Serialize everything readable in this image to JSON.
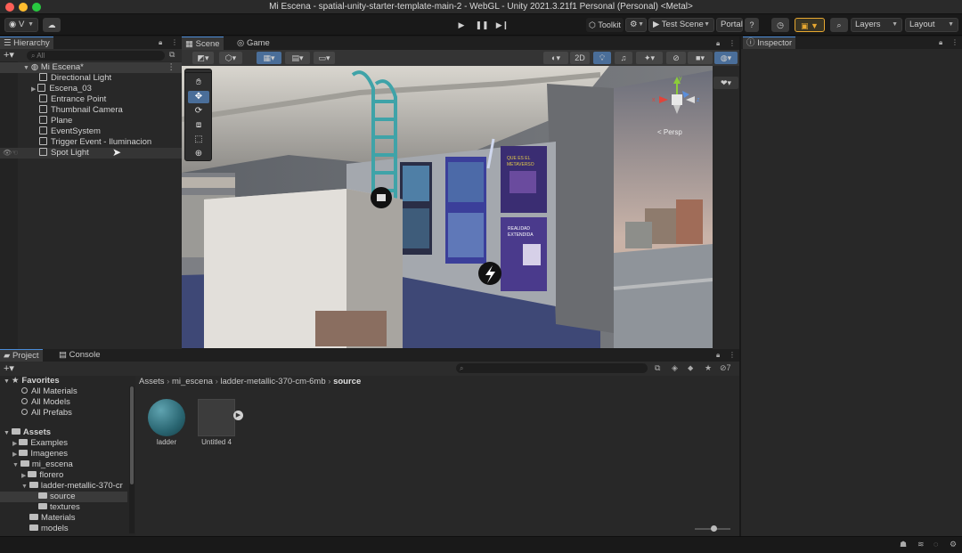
{
  "window": {
    "title": "Mi Escena - spatial-unity-starter-template-main-2 - WebGL - Unity 2021.3.21f1 Personal (Personal) <Metal>"
  },
  "toolbar": {
    "account_label": "V",
    "toolkit_label": "Toolkit",
    "test_scene_label": "Test Scene",
    "portal_label": "Portal",
    "layers_label": "Layers",
    "layout_label": "Layout"
  },
  "hierarchy": {
    "tab_label": "Hierarchy",
    "search_placeholder": "All",
    "scene_name": "Mi Escena*",
    "items": [
      {
        "label": "Directional Light"
      },
      {
        "label": "Escena_03"
      },
      {
        "label": "Entrance Point"
      },
      {
        "label": "Thumbnail Camera"
      },
      {
        "label": "Plane"
      },
      {
        "label": "EventSystem"
      },
      {
        "label": "Trigger Event - Iluminacion"
      },
      {
        "label": "Spot Light"
      }
    ]
  },
  "scene": {
    "tabs": [
      {
        "label": "Scene"
      },
      {
        "label": "Game"
      }
    ],
    "mode_2d_label": "2D",
    "gizmo_label": "< Persp",
    "axis_labels": {
      "x": "x",
      "y": "y",
      "z": "z"
    },
    "poster_texts": {
      "poster1_line1": "QUE ES EL",
      "poster1_line2": "METAVERSO",
      "poster2_line1": "REALIDAD",
      "poster2_line2": "EXTENDIDA"
    }
  },
  "inspector": {
    "tab_label": "Inspector"
  },
  "project": {
    "tabs": [
      {
        "label": "Project"
      },
      {
        "label": "Console"
      }
    ],
    "favorites_label": "Favorites",
    "favorites": [
      {
        "label": "All Materials"
      },
      {
        "label": "All Models"
      },
      {
        "label": "All Prefabs"
      }
    ],
    "assets_label": "Assets",
    "tree": [
      {
        "label": "Examples"
      },
      {
        "label": "Imagenes"
      },
      {
        "label": "mi_escena"
      },
      {
        "label": "florero"
      },
      {
        "label": "ladder-metallic-370-cr"
      },
      {
        "label": "source"
      },
      {
        "label": "textures"
      },
      {
        "label": "Materials"
      },
      {
        "label": "models"
      }
    ],
    "breadcrumb": [
      {
        "label": "Assets"
      },
      {
        "label": "mi_escena"
      },
      {
        "label": "ladder-metallic-370-cm-6mb"
      },
      {
        "label": "source"
      }
    ],
    "hidden_count": "7",
    "assets": [
      {
        "label": "ladder"
      },
      {
        "label": "Untitled 4"
      }
    ]
  },
  "colors": {
    "accent": "#4a8cd8",
    "selection": "#2e3d50",
    "panel": "#282828"
  }
}
